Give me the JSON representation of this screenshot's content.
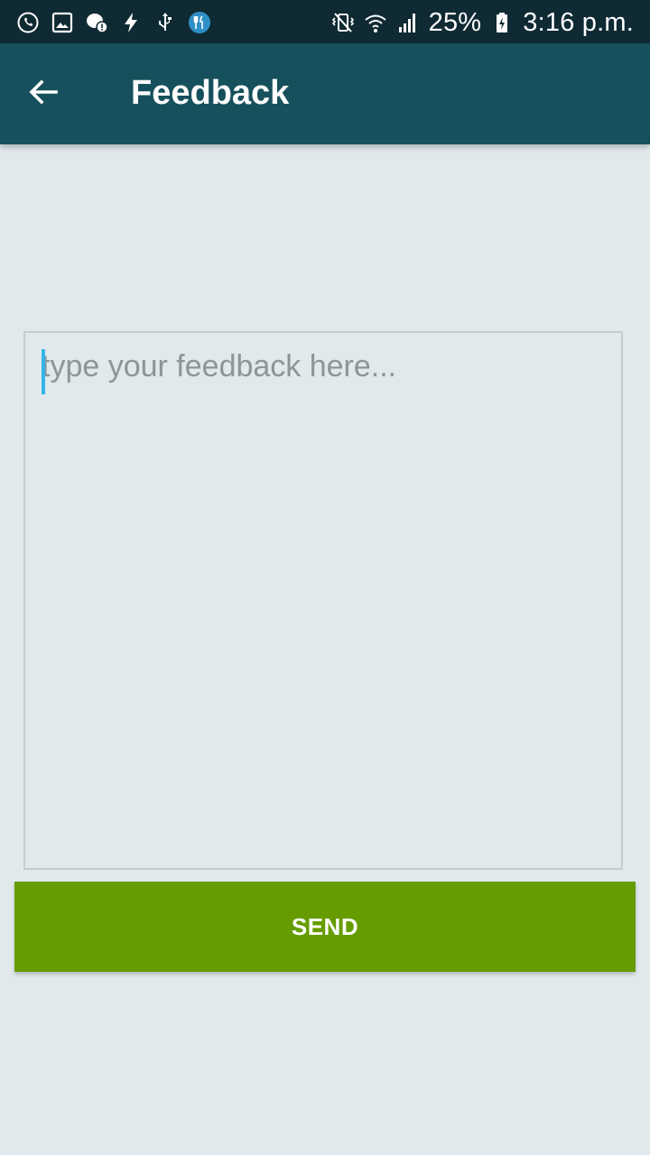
{
  "status_bar": {
    "left_icons": [
      "whatsapp-icon",
      "gallery-icon",
      "messenger-alert-icon",
      "flash-icon",
      "usb-icon",
      "restaurant-icon"
    ],
    "right_icons": [
      "vibrate-icon",
      "wifi-icon",
      "signal-icon",
      "battery-charging-icon"
    ],
    "battery": "25%",
    "time": "3:16 p.m."
  },
  "app_bar": {
    "back_icon": "arrow-back-icon",
    "title": "Feedback"
  },
  "feedback": {
    "placeholder": "type your feedback here...",
    "value": ""
  },
  "send_button": {
    "label": "SEND"
  },
  "colors": {
    "status_bar": "#0f2a33",
    "app_bar": "#17505d",
    "background": "#e1e9ec",
    "send_button": "#669c00",
    "cursor": "#33b5e5"
  }
}
